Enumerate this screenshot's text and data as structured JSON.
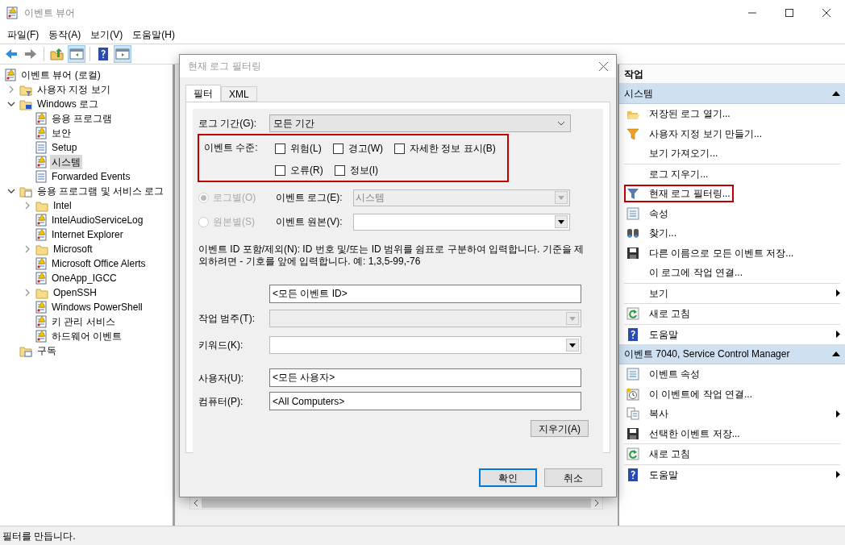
{
  "window": {
    "title": "이벤트 뷰어"
  },
  "menu": [
    {
      "label": "파일(F)"
    },
    {
      "label": "동작(A)"
    },
    {
      "label": "보기(V)"
    },
    {
      "label": "도움말(H)"
    }
  ],
  "toolbar": [
    {
      "kind": "back",
      "active": false
    },
    {
      "kind": "forward",
      "active": false
    },
    {
      "kind": "up",
      "active": false
    },
    {
      "kind": "tree-pane",
      "active": true
    },
    {
      "kind": "help",
      "active": false
    },
    {
      "kind": "action-pane",
      "active": true
    }
  ],
  "tree": [
    {
      "label": "이벤트 뷰어 (로컬)",
      "kind": "root",
      "selected": false,
      "children": [
        {
          "label": "사용자 지정 보기",
          "kind": "custom",
          "expanded": false,
          "selected": false
        },
        {
          "label": "Windows 로그",
          "kind": "winlogs",
          "expanded": true,
          "selected": false,
          "children": [
            {
              "label": "응용 프로그램",
              "kind": "log",
              "selected": false
            },
            {
              "label": "보안",
              "kind": "log",
              "selected": false
            },
            {
              "label": "Setup",
              "kind": "plainlog",
              "selected": false
            },
            {
              "label": "시스템",
              "kind": "log",
              "selected": true
            },
            {
              "label": "Forwarded Events",
              "kind": "plainlog",
              "selected": false
            }
          ]
        },
        {
          "label": "응용 프로그램 및 서비스 로그",
          "kind": "appfolder",
          "expanded": true,
          "selected": false,
          "children": [
            {
              "label": "Intel",
              "kind": "folder",
              "expanded": false,
              "selected": false
            },
            {
              "label": "IntelAudioServiceLog",
              "kind": "log",
              "selected": false
            },
            {
              "label": "Internet Explorer",
              "kind": "log",
              "selected": false
            },
            {
              "label": "Microsoft",
              "kind": "folder",
              "expanded": false,
              "selected": false
            },
            {
              "label": "Microsoft Office Alerts",
              "kind": "log",
              "selected": false
            },
            {
              "label": "OneApp_IGCC",
              "kind": "log",
              "selected": false
            },
            {
              "label": "OpenSSH",
              "kind": "folder",
              "expanded": false,
              "selected": false
            },
            {
              "label": "Windows PowerShell",
              "kind": "log",
              "selected": false
            },
            {
              "label": "키 관리 서비스",
              "kind": "log",
              "selected": false
            },
            {
              "label": "하드웨어 이벤트",
              "kind": "log",
              "selected": false
            }
          ]
        },
        {
          "label": "구독",
          "kind": "subscription",
          "selected": false
        }
      ]
    }
  ],
  "dialog": {
    "title": "현재 로그 필터링",
    "tabs": [
      {
        "label": "필터",
        "selected": true
      },
      {
        "label": "XML",
        "selected": false
      }
    ],
    "period": {
      "label": "로그 기간(G):",
      "value": "모든 기간"
    },
    "levels": {
      "label": "이벤트 수준:",
      "highlighted": true,
      "options": [
        {
          "label": "위험(L)",
          "checked": false
        },
        {
          "label": "경고(W)",
          "checked": false
        },
        {
          "label": "자세한 정보 표시(B)",
          "checked": false
        },
        {
          "label": "오류(R)",
          "checked": false
        },
        {
          "label": "정보(I)",
          "checked": false
        }
      ]
    },
    "scope": [
      {
        "radio": "로그별(O)",
        "selected": true,
        "field_label": "이벤트 로그(E):",
        "value": "시스템",
        "disabled": true
      },
      {
        "radio": "원본별(S)",
        "selected": false,
        "field_label": "이벤트 원본(V):",
        "disabled": false
      }
    ],
    "description": "이벤트 ID 포함/제외(N): ID 번호 및/또는 ID 범위를 쉼표로 구분하여 입력합니다. 기준을 제외하려면 - 기호를 앞에 입력합니다. 예: 1,3,5-99,-76",
    "event_ids": {
      "value": "<모든 이벤트 ID>"
    },
    "task_category": {
      "label": "작업 범주(T):",
      "disabled": true
    },
    "keywords": {
      "label": "키워드(K):",
      "disabled": false
    },
    "user": {
      "label": "사용자(U):",
      "value": "<모든 사용자>"
    },
    "computer": {
      "label": "컴퓨터(P):",
      "value": "<All Computers>"
    },
    "clear_button": "지우기(A)",
    "ok_button": "확인",
    "cancel_button": "취소"
  },
  "actions": {
    "title": "작업",
    "sections": [
      {
        "title": "시스템",
        "expanded": true,
        "groups": [
          {
            "items": [
              {
                "label": "저장된 로그 열기...",
                "kind": "open",
                "submenu": false,
                "highlighted": false
              },
              {
                "label": "사용자 지정 보기 만들기...",
                "kind": "filter-color",
                "submenu": false,
                "highlighted": false
              },
              {
                "label": "보기 가져오기...",
                "kind": "plain",
                "submenu": false,
                "highlighted": false
              }
            ]
          },
          {
            "items": [
              {
                "label": "로그 지우기...",
                "kind": "plain",
                "submenu": false,
                "highlighted": false
              },
              {
                "label": "현재 로그 필터링...",
                "kind": "filter",
                "submenu": false,
                "highlighted": true
              },
              {
                "label": "속성",
                "kind": "properties",
                "submenu": false,
                "highlighted": false
              },
              {
                "label": "찾기...",
                "kind": "binoculars",
                "submenu": false,
                "highlighted": false
              },
              {
                "label": "다른 이름으로 모든 이벤트 저장...",
                "kind": "save",
                "submenu": false,
                "highlighted": false
              },
              {
                "label": "이 로그에 작업 연결...",
                "kind": "plain",
                "submenu": false,
                "highlighted": false
              }
            ]
          },
          {
            "items": [
              {
                "label": "보기",
                "kind": "plain",
                "submenu": true,
                "highlighted": false
              }
            ]
          },
          {
            "items": [
              {
                "label": "새로 고침",
                "kind": "refresh",
                "submenu": false,
                "highlighted": false
              }
            ]
          },
          {
            "items": [
              {
                "label": "도움말",
                "kind": "help",
                "submenu": true,
                "highlighted": false
              }
            ]
          }
        ]
      },
      {
        "title": "이벤트 7040, Service Control Manager",
        "expanded": true,
        "groups": [
          {
            "items": [
              {
                "label": "이벤트 속성",
                "kind": "properties",
                "submenu": false,
                "highlighted": false
              },
              {
                "label": "이 이벤트에 작업 연결...",
                "kind": "clock",
                "submenu": false,
                "highlighted": false
              },
              {
                "label": "복사",
                "kind": "copy",
                "submenu": true,
                "highlighted": false
              },
              {
                "label": "선택한 이벤트 저장...",
                "kind": "save",
                "submenu": false,
                "highlighted": false
              }
            ]
          },
          {
            "items": [
              {
                "label": "새로 고침",
                "kind": "refresh",
                "submenu": false,
                "highlighted": false
              }
            ]
          },
          {
            "items": [
              {
                "label": "도움말",
                "kind": "help",
                "submenu": true,
                "highlighted": false
              }
            ]
          }
        ]
      }
    ]
  },
  "status_bar": {
    "text": "필터를 만듭니다."
  }
}
